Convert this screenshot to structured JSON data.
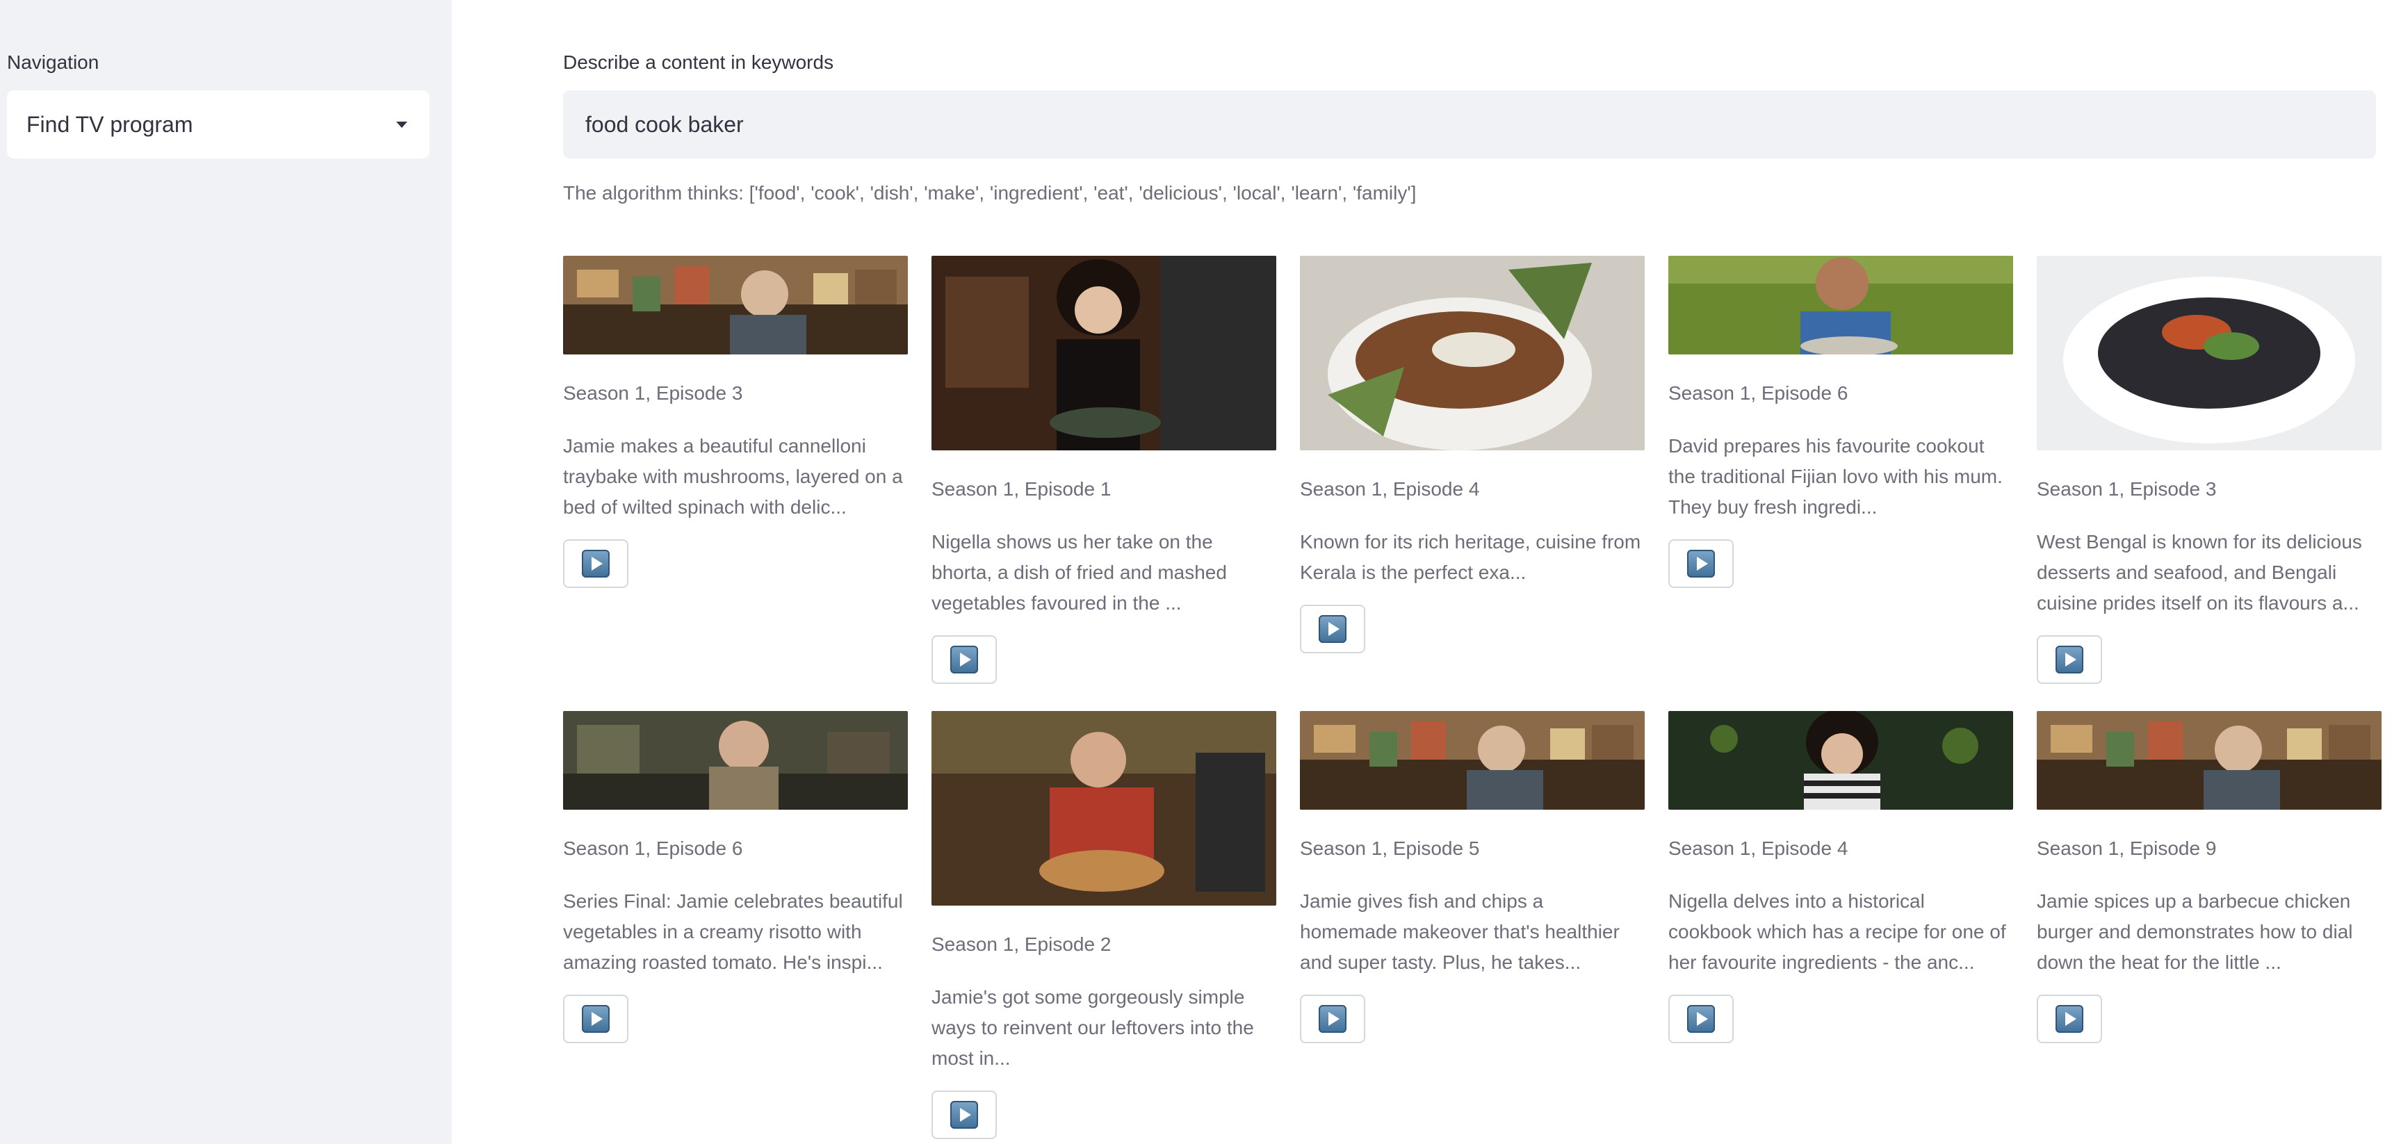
{
  "sidebar": {
    "label": "Navigation",
    "select_value": "Find TV program"
  },
  "main": {
    "input_label": "Describe a content in keywords",
    "input_value": "food cook baker",
    "algorithm_text": "The algorithm thinks: ['food', 'cook', 'dish', 'make', 'ingredient', 'eat', 'delicious', 'local', 'learn', 'family']"
  },
  "results": [
    {
      "episode": "Season 1, Episode 3",
      "description": "Jamie makes a beautiful cannelloni traybake with mushrooms, layered on a bed of wilted spinach with delic...",
      "thumbnail": "jamie-kitchen-shelves"
    },
    {
      "episode": "Season 1, Episode 1",
      "description": "Nigella shows us her take on the bhorta, a dish of fried and mashed vegetables favoured in the ...",
      "thumbnail": "nigella-kitchen"
    },
    {
      "episode": "Season 1, Episode 4",
      "description": "Known for its rich heritage, cuisine from Kerala is the perfect exa...",
      "thumbnail": "curry-bowl-banana-leaf"
    },
    {
      "episode": "Season 1, Episode 6",
      "description": "David prepares his favourite cookout the traditional Fijian lovo with his mum. They buy fresh ingredi...",
      "thumbnail": "boy-on-grass"
    },
    {
      "episode": "Season 1, Episode 3",
      "description": "West Bengal is known for its delicious desserts and seafood, and Bengali cuisine prides itself on its flavours a...",
      "thumbnail": "mussels-bowl"
    },
    {
      "episode": "Season 1, Episode 6",
      "description": "Series Final: Jamie celebrates beautiful vegetables in a creamy risotto with amazing roasted tomato. He's inspi...",
      "thumbnail": "jamie-rustic-kitchen"
    },
    {
      "episode": "Season 1, Episode 2",
      "description": "Jamie's got some gorgeously simple ways to reinvent our leftovers into the most in...",
      "thumbnail": "jamie-holding-pie"
    },
    {
      "episode": "Season 1, Episode 5",
      "description": "Jamie gives fish and chips a homemade makeover that's healthier and super tasty. Plus, he takes...",
      "thumbnail": "jamie-kitchen-shelves"
    },
    {
      "episode": "Season 1, Episode 4",
      "description": "Nigella delves into a historical cookbook which has a recipe for one of her favourite ingredients - the anc...",
      "thumbnail": "nigella-garden"
    },
    {
      "episode": "Season 1, Episode 9",
      "description": "Jamie spices up a barbecue chicken burger and demonstrates how to dial down the heat for the little ...",
      "thumbnail": "jamie-kitchen-shelves"
    }
  ],
  "icons": {
    "caret": "chevron-down-icon",
    "play": "play-icon"
  }
}
